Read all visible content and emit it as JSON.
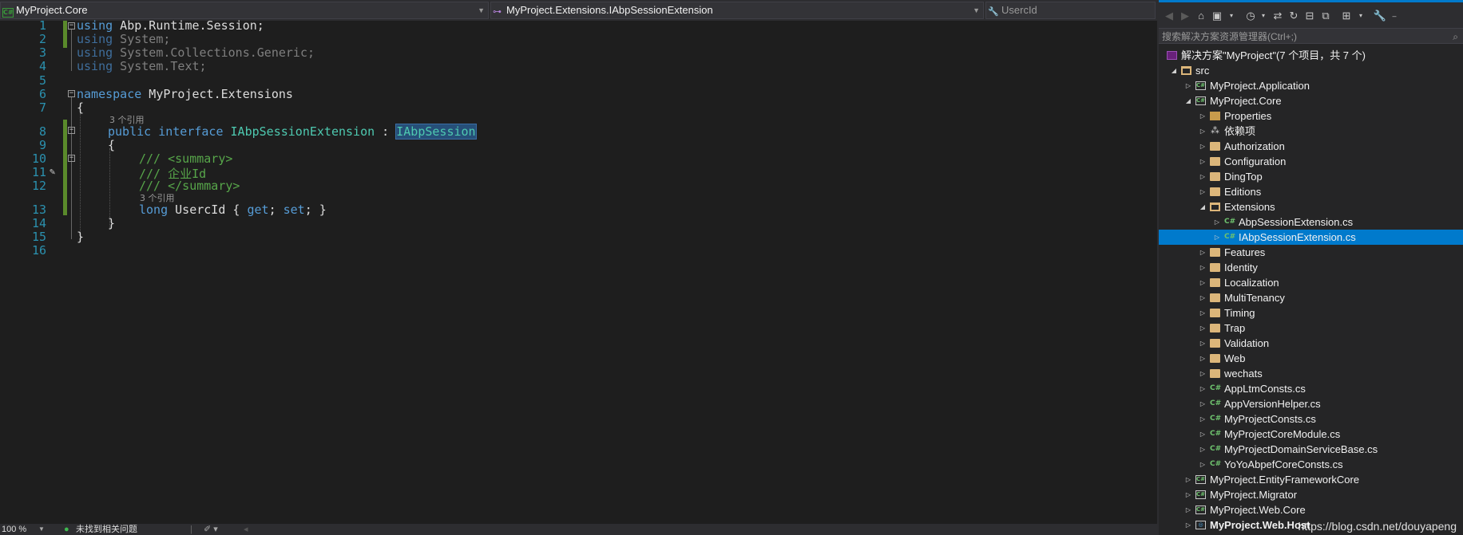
{
  "navbar": {
    "project": "MyProject.Core",
    "type": "MyProject.Extensions.IAbpSessionExtension",
    "member": "UsercId"
  },
  "editor": {
    "line_numbers": [
      "1",
      "2",
      "3",
      "4",
      "5",
      "6",
      "7",
      "8",
      "9",
      "10",
      "11",
      "12",
      "13",
      "14",
      "15",
      "16"
    ],
    "lines": {
      "l1_kw": "using",
      "l1_rest": " Abp.Runtime.Session;",
      "l2_kw": "using",
      "l2_rest": " System;",
      "l3_kw": "using",
      "l3_rest": " System.Collections.Generic;",
      "l4_kw": "using",
      "l4_rest": " System.Text;",
      "l6_kw": "namespace",
      "l6_rest": " MyProject.Extensions",
      "l7": "{",
      "lens1": "3 个引用",
      "l8_kw1": "public",
      "l8_kw2": "interface",
      "l8_name": "IAbpSessionExtension",
      "l8_colon": " : ",
      "l8_base": "IAbpSession",
      "l9": "{",
      "l10": "/// <summary>",
      "l11": "/// 企业Id",
      "l12": "/// </summary>",
      "lens2": "3 个引用",
      "l13_kw": "long",
      "l13_name": " UsercId { ",
      "l13_get": "get",
      "l13_semi1": "; ",
      "l13_set": "set",
      "l13_end": "; }",
      "l14": "}",
      "l15": "}"
    }
  },
  "status": {
    "zoom": "100 %",
    "issues": "未找到相关问题"
  },
  "solution_explorer": {
    "search_placeholder": "搜索解决方案资源管理器(Ctrl+;)",
    "tree": [
      {
        "label": "解决方案\"MyProject\"(7 个项目，共 7 个)",
        "icon": "solution-icon",
        "level": 0,
        "expander": ""
      },
      {
        "label": "src",
        "icon": "folder-open-icon",
        "level": 1,
        "expander": "open"
      },
      {
        "label": "MyProject.Application",
        "icon": "csharp-project-icon",
        "level": 2,
        "expander": "closed"
      },
      {
        "label": "MyProject.Core",
        "icon": "csharp-project-icon",
        "level": 2,
        "expander": "open"
      },
      {
        "label": "Properties",
        "icon": "properties-icon",
        "level": 3,
        "expander": "closed"
      },
      {
        "label": "依赖项",
        "icon": "dependencies-icon",
        "level": 3,
        "expander": "closed"
      },
      {
        "label": "Authorization",
        "icon": "folder-icon",
        "level": 3,
        "expander": "closed"
      },
      {
        "label": "Configuration",
        "icon": "folder-icon",
        "level": 3,
        "expander": "closed"
      },
      {
        "label": "DingTop",
        "icon": "folder-icon",
        "level": 3,
        "expander": "closed"
      },
      {
        "label": "Editions",
        "icon": "folder-icon",
        "level": 3,
        "expander": "closed"
      },
      {
        "label": "Extensions",
        "icon": "folder-open-icon",
        "level": 3,
        "expander": "open"
      },
      {
        "label": "AbpSessionExtension.cs",
        "icon": "csharp-file-icon",
        "level": 4,
        "expander": "closed"
      },
      {
        "label": "IAbpSessionExtension.cs",
        "icon": "csharp-file-icon",
        "level": 4,
        "expander": "closed",
        "selected": true
      },
      {
        "label": "Features",
        "icon": "folder-icon",
        "level": 3,
        "expander": "closed"
      },
      {
        "label": "Identity",
        "icon": "folder-icon",
        "level": 3,
        "expander": "closed"
      },
      {
        "label": "Localization",
        "icon": "folder-icon",
        "level": 3,
        "expander": "closed"
      },
      {
        "label": "MultiTenancy",
        "icon": "folder-icon",
        "level": 3,
        "expander": "closed"
      },
      {
        "label": "Timing",
        "icon": "folder-icon",
        "level": 3,
        "expander": "closed"
      },
      {
        "label": "Trap",
        "icon": "folder-icon",
        "level": 3,
        "expander": "closed"
      },
      {
        "label": "Validation",
        "icon": "folder-icon",
        "level": 3,
        "expander": "closed"
      },
      {
        "label": "Web",
        "icon": "folder-icon",
        "level": 3,
        "expander": "closed"
      },
      {
        "label": "wechats",
        "icon": "folder-icon",
        "level": 3,
        "expander": "closed"
      },
      {
        "label": "AppLtmConsts.cs",
        "icon": "csharp-file-icon",
        "level": 3,
        "expander": "closed"
      },
      {
        "label": "AppVersionHelper.cs",
        "icon": "csharp-file-icon",
        "level": 3,
        "expander": "closed"
      },
      {
        "label": "MyProjectConsts.cs",
        "icon": "csharp-file-icon",
        "level": 3,
        "expander": "closed"
      },
      {
        "label": "MyProjectCoreModule.cs",
        "icon": "csharp-file-icon",
        "level": 3,
        "expander": "closed"
      },
      {
        "label": "MyProjectDomainServiceBase.cs",
        "icon": "csharp-file-icon",
        "level": 3,
        "expander": "closed"
      },
      {
        "label": "YoYoAbpefCoreConsts.cs",
        "icon": "csharp-file-icon",
        "level": 3,
        "expander": "closed"
      },
      {
        "label": "MyProject.EntityFrameworkCore",
        "icon": "csharp-project-icon",
        "level": 2,
        "expander": "closed"
      },
      {
        "label": "MyProject.Migrator",
        "icon": "csharp-project-icon",
        "level": 2,
        "expander": "closed"
      },
      {
        "label": "MyProject.Web.Core",
        "icon": "csharp-project-icon",
        "level": 2,
        "expander": "closed"
      },
      {
        "label": "MyProject.Web.Host",
        "icon": "web-project-icon",
        "level": 2,
        "expander": "closed",
        "bold": true
      }
    ]
  },
  "watermark": "https://blog.csdn.net/douyapeng",
  "colors": {
    "accent": "#007acc",
    "keyword": "#569cd6",
    "type": "#4ec9b0",
    "comment": "#57a64a",
    "line_number": "#2b91af"
  }
}
